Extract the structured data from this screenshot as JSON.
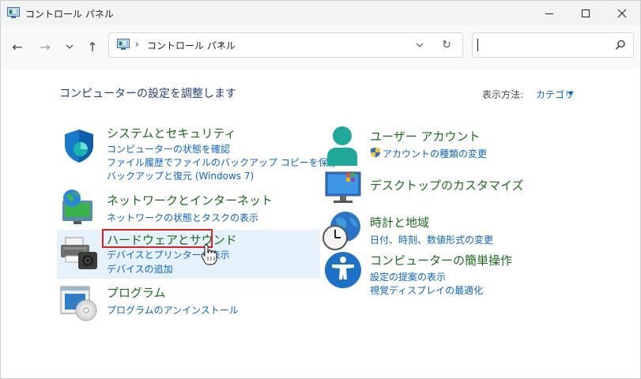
{
  "window": {
    "title": "コントロール パネル"
  },
  "address_bar": {
    "location": "コントロール パネル"
  },
  "search": {
    "value": ""
  },
  "heading": "コンピューターの設定を調整します",
  "view_by": {
    "label": "表示方法:",
    "value": "カテゴリ"
  },
  "colors": {
    "category_title": "#1a6b1a",
    "link": "#0b64c0",
    "heading": "#1e3f7a",
    "highlight": "#e5f1fb",
    "annotation_box": "#e02020"
  },
  "categories": {
    "security": {
      "icon": "shield-icon",
      "title": "システムとセキュリティ",
      "links": [
        "コンピューターの状態を確認",
        "ファイル履歴でファイルのバックアップ コピーを保存",
        "バックアップと復元 (Windows 7)"
      ]
    },
    "network": {
      "icon": "network-globe-icon",
      "title": "ネットワークとインターネット",
      "links": [
        "ネットワークの状態とタスクの表示"
      ]
    },
    "hardware": {
      "icon": "printer-camera-icon",
      "title": "ハードウェアとサウンド",
      "links": [
        "デバイスとプリンターの表示",
        "デバイスの追加"
      ]
    },
    "programs": {
      "icon": "programs-disc-icon",
      "title": "プログラム",
      "links": [
        "プログラムのアンインストール"
      ]
    },
    "user_accounts": {
      "icon": "user-icon",
      "title": "ユーザー アカウント",
      "links": [
        "アカウントの種類の変更"
      ]
    },
    "appearance": {
      "icon": "desktop-monitor-icon",
      "title": "デスクトップのカスタマイズ",
      "links": []
    },
    "clock_region": {
      "icon": "clock-globe-icon",
      "title": "時計と地域",
      "links": [
        "日付、時刻、数値形式の変更"
      ]
    },
    "ease_of_access": {
      "icon": "accessibility-icon",
      "title": "コンピューターの簡単操作",
      "links": [
        "設定の提案の表示",
        "視覚ディスプレイの最適化"
      ]
    }
  }
}
